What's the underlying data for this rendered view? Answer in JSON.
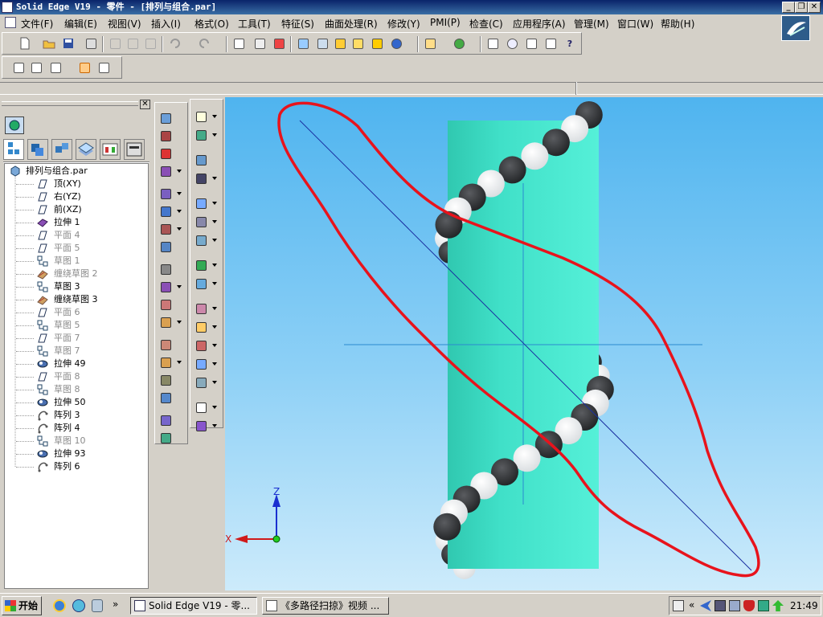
{
  "window": {
    "title": "Solid Edge V19 - 零件 - [排列与组合.par]"
  },
  "menu": [
    "文件(F)",
    "编辑(E)",
    "视图(V)",
    "插入(I)",
    "格式(O)",
    "工具(T)",
    "特征(S)",
    "曲面处理(R)",
    "修改(Y)",
    "PMI(P)",
    "检查(C)",
    "应用程序(A)",
    "管理(M)",
    "窗口(W)",
    "帮助(H)"
  ],
  "tree": {
    "root": "排列与组合.par",
    "items": [
      {
        "label": "顶(XY)",
        "icon": "plane-icon",
        "dim": false
      },
      {
        "label": "右(YZ)",
        "icon": "plane-icon",
        "dim": false
      },
      {
        "label": "前(XZ)",
        "icon": "plane-icon",
        "dim": false
      },
      {
        "label": "拉伸 1",
        "icon": "extrude-icon",
        "dim": false
      },
      {
        "label": "平面 4",
        "icon": "plane-icon",
        "dim": true
      },
      {
        "label": "平面 5",
        "icon": "plane-icon",
        "dim": true
      },
      {
        "label": "草图 1",
        "icon": "sketch-icon",
        "dim": true
      },
      {
        "label": "缠绕草图 2",
        "icon": "wrap-sketch-icon",
        "dim": true
      },
      {
        "label": "草图 3",
        "icon": "sketch-icon",
        "dim": false
      },
      {
        "label": "缠绕草图 3",
        "icon": "wrap-sketch-icon",
        "dim": false
      },
      {
        "label": "平面 6",
        "icon": "plane-icon",
        "dim": true
      },
      {
        "label": "草图 5",
        "icon": "sketch-icon",
        "dim": true
      },
      {
        "label": "平面 7",
        "icon": "plane-icon",
        "dim": true
      },
      {
        "label": "草图 7",
        "icon": "sketch-icon",
        "dim": true
      },
      {
        "label": "拉伸 49",
        "icon": "revolve-icon",
        "dim": false
      },
      {
        "label": "平面 8",
        "icon": "plane-icon",
        "dim": true
      },
      {
        "label": "草图 8",
        "icon": "sketch-icon",
        "dim": true
      },
      {
        "label": "拉伸 50",
        "icon": "revolve-icon",
        "dim": false
      },
      {
        "label": "阵列 3",
        "icon": "pattern-icon",
        "dim": false
      },
      {
        "label": "阵列 4",
        "icon": "pattern-icon",
        "dim": false
      },
      {
        "label": "草图 10",
        "icon": "sketch-icon",
        "dim": true
      },
      {
        "label": "拉伸 93",
        "icon": "revolve-icon",
        "dim": false
      },
      {
        "label": "阵列 6",
        "icon": "pattern-icon",
        "dim": false
      }
    ]
  },
  "triad": {
    "z": "Z",
    "x": "X"
  },
  "taskbar": {
    "start": "开始",
    "chevron": "»",
    "tasks": [
      "Solid Edge V19 - 零...",
      "《多路径扫掠》视频 ..."
    ],
    "tray_chevron": "«",
    "clock": "21:49"
  },
  "colors": {
    "cylinder": "#40e0c8",
    "annotation": "#e8131c",
    "viewport_top": "#4fb4ef",
    "viewport_bottom": "#cdebfb",
    "ball_dark": "#303234",
    "ball_light": "#ffffff"
  }
}
